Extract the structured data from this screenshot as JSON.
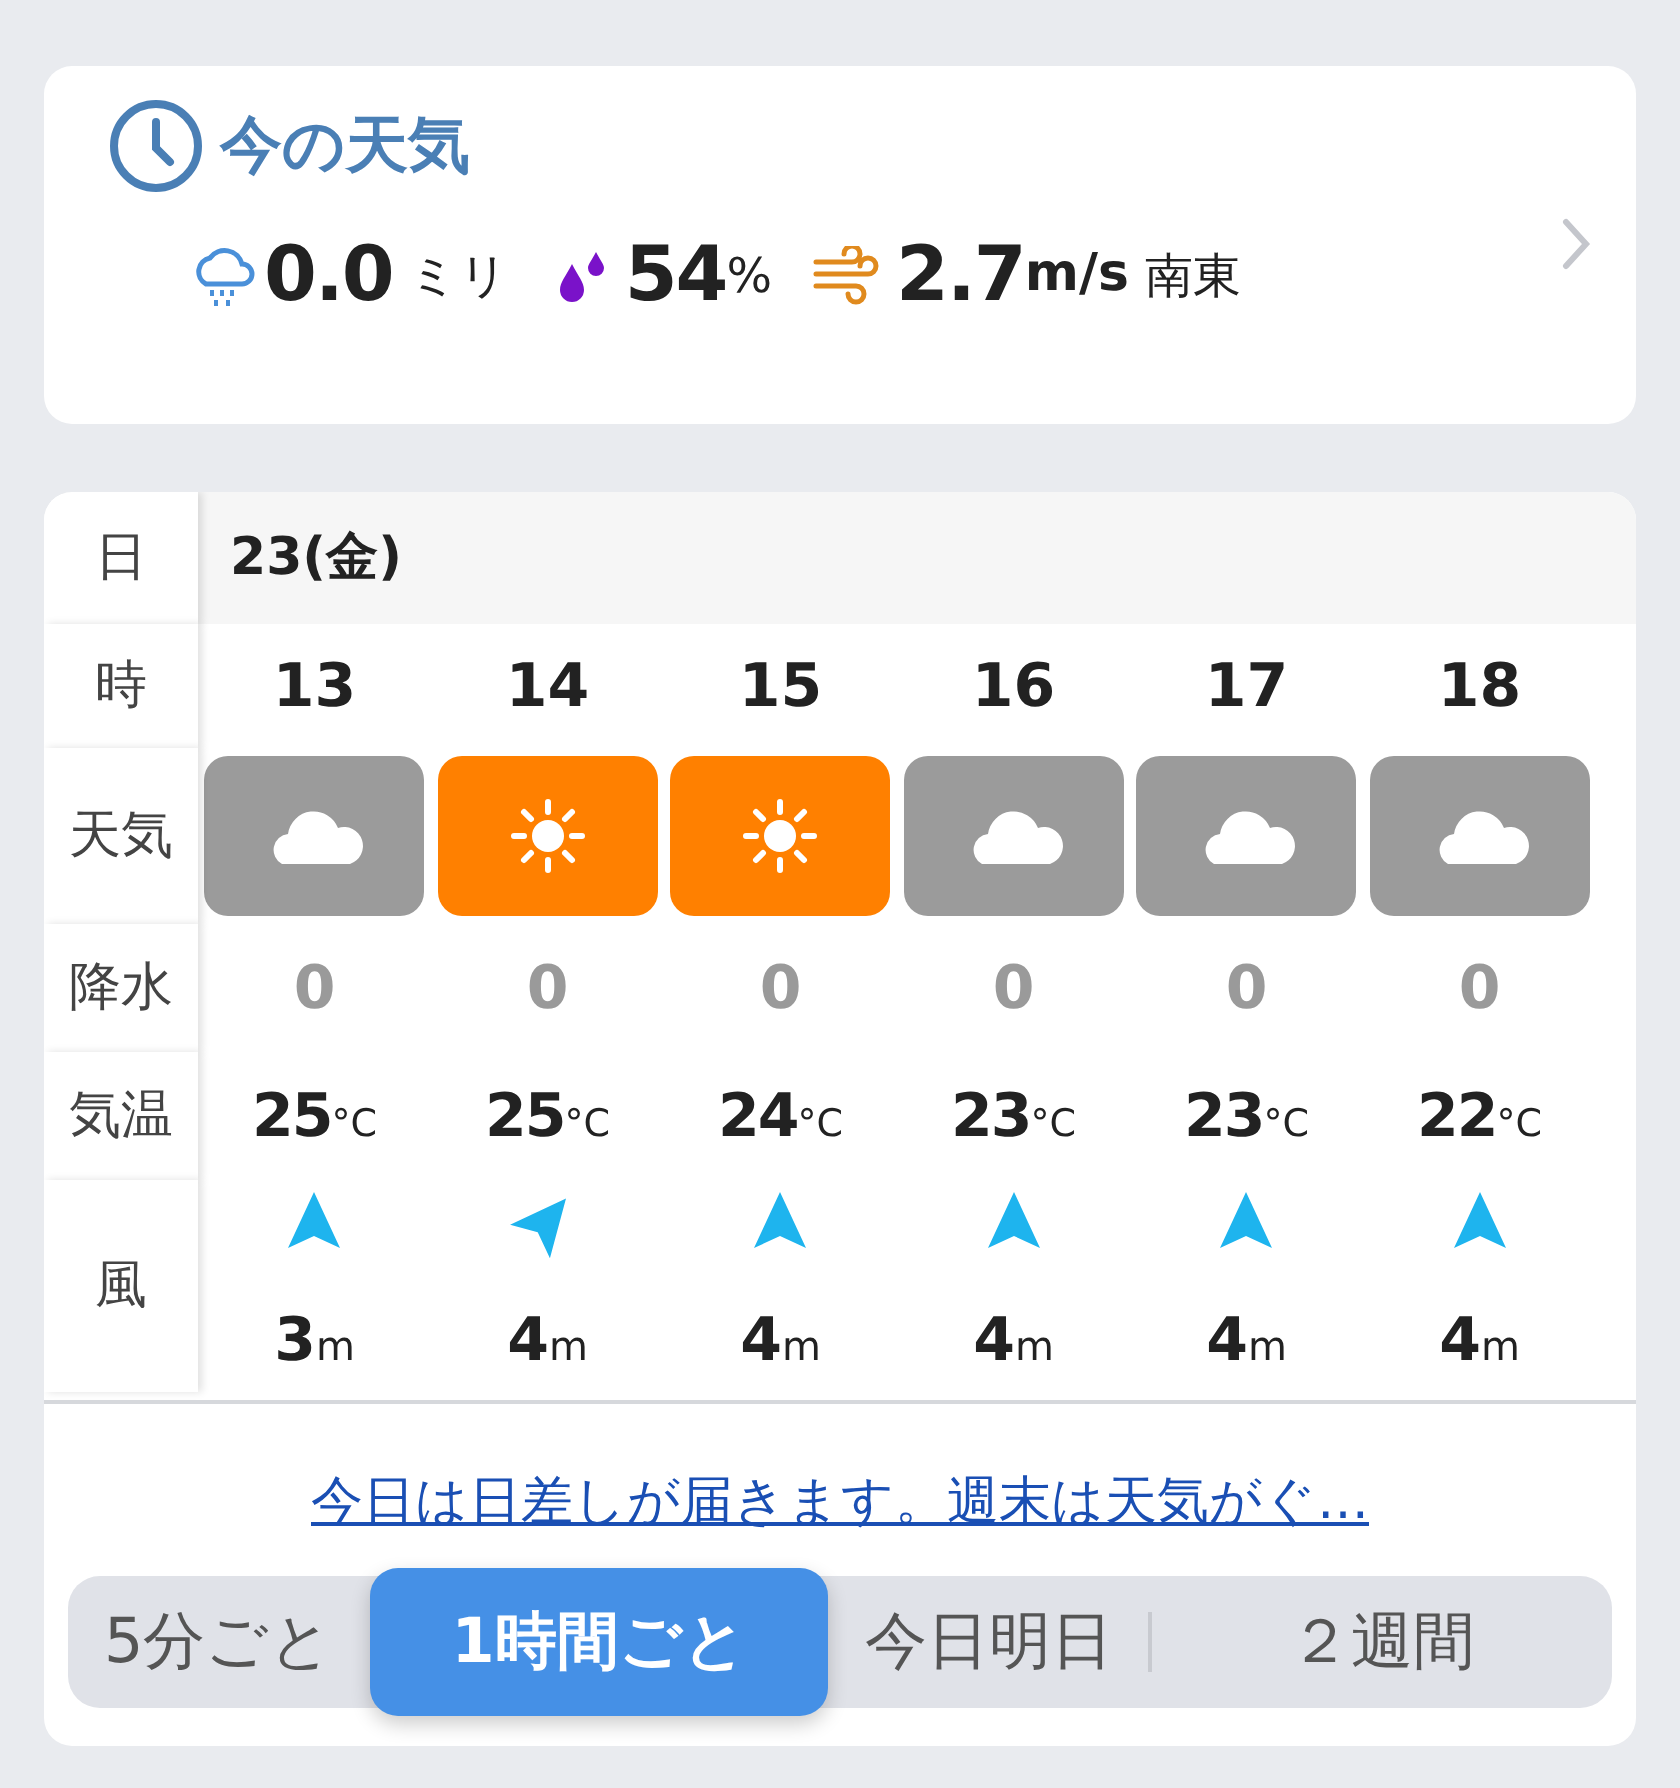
{
  "current": {
    "title": "今の天気",
    "rain_value": "0.0",
    "rain_unit": "ミリ",
    "humidity_value": "54",
    "humidity_unit": "%",
    "wind_value": "2.7",
    "wind_unit": "m/s",
    "wind_direction": "南東"
  },
  "forecast": {
    "labels": {
      "date": "日",
      "hour": "時",
      "weather": "天気",
      "precip": "降水",
      "temp": "気温",
      "wind": "風"
    },
    "date": "23(金)",
    "hours": [
      {
        "hour": "13",
        "weather": {
          "kind": "cloudy"
        },
        "precip": "0",
        "temp": "25",
        "temp_unit": "°C",
        "wind_arrow": {
          "kind": "north"
        },
        "wind": "3",
        "wind_unit": "m"
      },
      {
        "hour": "14",
        "weather": {
          "kind": "sunny"
        },
        "precip": "0",
        "temp": "25",
        "temp_unit": "°C",
        "wind_arrow": {
          "kind": "northeast"
        },
        "wind": "4",
        "wind_unit": "m"
      },
      {
        "hour": "15",
        "weather": {
          "kind": "sunny"
        },
        "precip": "0",
        "temp": "24",
        "temp_unit": "°C",
        "wind_arrow": {
          "kind": "north"
        },
        "wind": "4",
        "wind_unit": "m"
      },
      {
        "hour": "16",
        "weather": {
          "kind": "cloudy"
        },
        "precip": "0",
        "temp": "23",
        "temp_unit": "°C",
        "wind_arrow": {
          "kind": "north"
        },
        "wind": "4",
        "wind_unit": "m"
      },
      {
        "hour": "17",
        "weather": {
          "kind": "cloudy"
        },
        "precip": "0",
        "temp": "23",
        "temp_unit": "°C",
        "wind_arrow": {
          "kind": "north"
        },
        "wind": "4",
        "wind_unit": "m"
      },
      {
        "hour": "18",
        "weather": {
          "kind": "cloudy"
        },
        "precip": "0",
        "temp": "22",
        "temp_unit": "°C",
        "wind_arrow": {
          "kind": "north"
        },
        "wind": "4",
        "wind_unit": "m"
      }
    ]
  },
  "headline_link": "今日は日差しが届きます。週末は天気がぐ…",
  "segments": [
    {
      "label": "5分ごと",
      "selected": false
    },
    {
      "label": "1時間ごと",
      "selected": true
    },
    {
      "label": "今日明日",
      "selected": false
    },
    {
      "label": "２週間",
      "selected": false
    }
  ]
}
